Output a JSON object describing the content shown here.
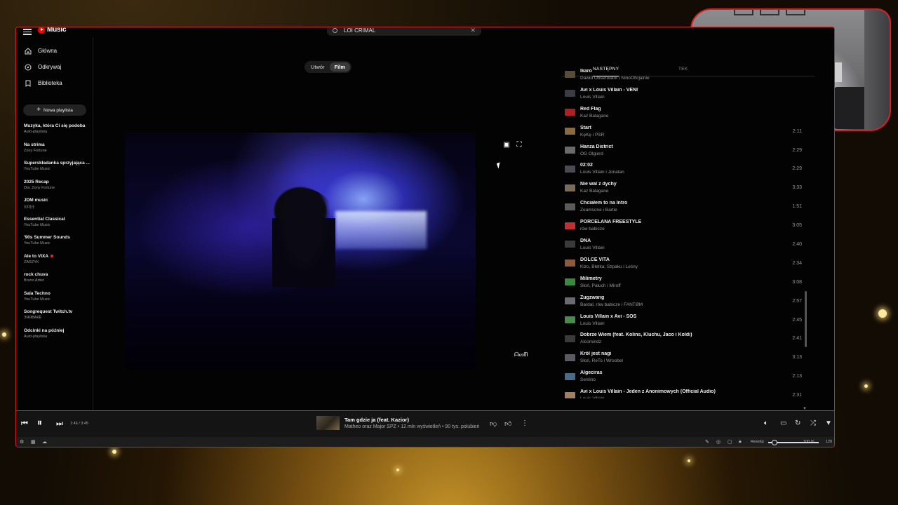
{
  "app": {
    "logo_text": "Music"
  },
  "search": {
    "value": "LOI CRIMAL",
    "placeholder": ""
  },
  "sidebar": {
    "nav": [
      {
        "label": "Główna",
        "icon": "home-icon"
      },
      {
        "label": "Odkrywaj",
        "icon": "explore-icon"
      },
      {
        "label": "Biblioteka",
        "icon": "library-icon"
      }
    ],
    "new_playlist": "Nowa playlista",
    "playlists": [
      {
        "title": "Muzyka, która Ci się podoba",
        "subtitle": "Auto-playlista"
      },
      {
        "title": "Na strima",
        "subtitle": "Zony Fortune"
      },
      {
        "title": "Superskładanka sprzyjająca ...",
        "subtitle": "YouTube Music"
      },
      {
        "title": "2025 Recap",
        "subtitle": "Dla: Zony Fortune"
      },
      {
        "title": "JDM music",
        "subtitle": "이대규"
      },
      {
        "title": "Essential Classical",
        "subtitle": "YouTube Music"
      },
      {
        "title": "'90s Summer Sounds",
        "subtitle": "YouTube Music"
      },
      {
        "title": "Ale to VIXA",
        "subtitle": "ZARZYK"
      },
      {
        "title": "rock chuva",
        "subtitle": "Bruno Artist"
      },
      {
        "title": "Sala Techno",
        "subtitle": "YouTube Music"
      },
      {
        "title": "Songrequest Twitch.tv",
        "subtitle": "ЗЯЯВАКЁ"
      },
      {
        "title": "Odcinki na później",
        "subtitle": "Auto-playlista"
      }
    ]
  },
  "toggle": {
    "song": "Utwór",
    "video": "Film",
    "active": "video"
  },
  "queue": {
    "tab_next": "NASTĘPNY",
    "tab_lyrics": "TEK",
    "items": [
      {
        "title": "Ikaro",
        "artist": "Dawid Obserwator i NinoOficjalnie",
        "duration": "",
        "thumb": "#5a4a3a"
      },
      {
        "title": "Avi x Louis Villain - VENI",
        "artist": "Louis Villain",
        "duration": "",
        "thumb": "#3c3c44"
      },
      {
        "title": "Red Flag",
        "artist": "Kaz Balagane",
        "duration": "",
        "thumb": "#b02020"
      },
      {
        "title": "Start",
        "artist": "KęKę i PSR",
        "duration": "2:11",
        "thumb": "#8a6a40"
      },
      {
        "title": "Hanza District",
        "artist": "OG Olgierd",
        "duration": "2:29",
        "thumb": "#6a6a6a"
      },
      {
        "title": "02:02",
        "artist": "Louis Villain i Jonatan",
        "duration": "2:29",
        "thumb": "#4a4a52"
      },
      {
        "title": "Nie wal z dychy",
        "artist": "Kaz Balagane",
        "duration": "3:33",
        "thumb": "#7a6a5a"
      },
      {
        "title": "Chciałem to na Intro",
        "artist": "Zeamsone i Bartie",
        "duration": "1:51",
        "thumb": "#5a5a5a"
      },
      {
        "title": "PORCELANA FREESTYLE",
        "artist": "rów babicze",
        "duration": "3:05",
        "thumb": "#c03030"
      },
      {
        "title": "DNA",
        "artist": "Louis Villain",
        "duration": "2:40",
        "thumb": "#3a3a3a"
      },
      {
        "title": "DOLCE VITA",
        "artist": "Kizo, Bletka, Szpaku i Leśny",
        "duration": "2:34",
        "thumb": "#8a5a3a"
      },
      {
        "title": "Milimetry",
        "artist": "Słoń, Paluch i Miroff",
        "duration": "3:08",
        "thumb": "#3a8a3a"
      },
      {
        "title": "Zugzwang",
        "artist": "Bardal, rów babicze i FANTØM",
        "duration": "2:57",
        "thumb": "#6a6a70"
      },
      {
        "title": "Louis Villain x Avi - SOS",
        "artist": "Louis Villain",
        "duration": "2:45",
        "thumb": "#4a8a4a"
      },
      {
        "title": "Dobrze Wiem (feat. Kolins, Kluchu, Jaco i Koldi)",
        "artist": "Alcomindz",
        "duration": "2:41",
        "thumb": "#3a3a3a"
      },
      {
        "title": "Król jest nagi",
        "artist": "Słoń, ReTo i Wroobel",
        "duration": "3:13",
        "thumb": "#5a5a60"
      },
      {
        "title": "Algeciras",
        "artist": "Sentino",
        "duration": "2:13",
        "thumb": "#4a6a8a"
      },
      {
        "title": "Avi x Louis Villain - Jeden z Anonimowych (Official Audio)",
        "artist": "Louis Villain",
        "duration": "2:31",
        "thumb": "#a08060"
      }
    ]
  },
  "player": {
    "time": "1:46 / 3:45",
    "progress": 0.47,
    "track_title": "Tam gdzie ja (feat. Kazior)",
    "track_meta": "Matheo oraz Major SPZ • 12 mln wyświetleń • 90 tys. polubień"
  },
  "status": {
    "volume_label": "Resetuj",
    "volume_percent": "100 %",
    "volume_level": 1.0,
    "extra_value": "120"
  },
  "video": {
    "watermark": "ᗩᔕᗰ"
  },
  "colors": {
    "accent_border": "#d42020",
    "background": "#030303"
  }
}
